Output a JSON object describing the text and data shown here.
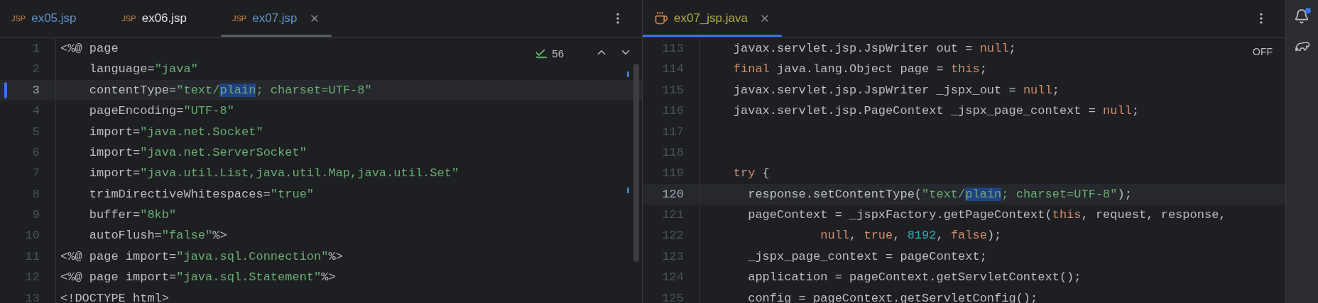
{
  "left_pane": {
    "tabs": [
      {
        "icon_text": "JSP",
        "label": "ex05.jsp",
        "color": "#5f93c9",
        "selected": false,
        "closable": false
      },
      {
        "icon_text": "JSP",
        "label": "ex06.jsp",
        "color": "#dfe1e5",
        "selected": false,
        "closable": false
      },
      {
        "icon_text": "JSP",
        "label": "ex07.jsp",
        "color": "#5f93c9",
        "selected": true,
        "closable": true
      }
    ],
    "inspections": {
      "count": "56"
    },
    "lines": [
      {
        "number": "1",
        "current": false,
        "tokens": [
          {
            "kind": "plain",
            "text": "<%@ page"
          }
        ]
      },
      {
        "number": "2",
        "current": false,
        "tokens": [
          {
            "kind": "plain",
            "text": "    language="
          },
          {
            "kind": "string",
            "text": "\"java\""
          }
        ]
      },
      {
        "number": "3",
        "current": true,
        "tokens": [
          {
            "kind": "plain",
            "text": "    contentType="
          },
          {
            "kind": "string",
            "text": "\"text/"
          },
          {
            "kind": "match",
            "text": "plain"
          },
          {
            "kind": "string",
            "text": "; charset=UTF-8\""
          }
        ]
      },
      {
        "number": "4",
        "current": false,
        "tokens": [
          {
            "kind": "plain",
            "text": "    pageEncoding="
          },
          {
            "kind": "string",
            "text": "\"UTF-8\""
          }
        ]
      },
      {
        "number": "5",
        "current": false,
        "tokens": [
          {
            "kind": "plain",
            "text": "    import="
          },
          {
            "kind": "string",
            "text": "\"java.net.Socket\""
          }
        ]
      },
      {
        "number": "6",
        "current": false,
        "tokens": [
          {
            "kind": "plain",
            "text": "    import="
          },
          {
            "kind": "string",
            "text": "\"java.net.ServerSocket\""
          }
        ]
      },
      {
        "number": "7",
        "current": false,
        "tokens": [
          {
            "kind": "plain",
            "text": "    import="
          },
          {
            "kind": "string",
            "text": "\"java.util.List,java.util.Map,java.util.Set\""
          }
        ]
      },
      {
        "number": "8",
        "current": false,
        "tokens": [
          {
            "kind": "plain",
            "text": "    trimDirectiveWhitespaces="
          },
          {
            "kind": "string",
            "text": "\"true\""
          }
        ]
      },
      {
        "number": "9",
        "current": false,
        "tokens": [
          {
            "kind": "plain",
            "text": "    buffer="
          },
          {
            "kind": "string",
            "text": "\"8kb\""
          }
        ]
      },
      {
        "number": "10",
        "current": false,
        "tokens": [
          {
            "kind": "plain",
            "text": "    autoFlush="
          },
          {
            "kind": "string",
            "text": "\"false\""
          },
          {
            "kind": "plain",
            "text": "%>"
          }
        ]
      },
      {
        "number": "11",
        "current": false,
        "tokens": [
          {
            "kind": "plain",
            "text": "<%@ page import="
          },
          {
            "kind": "string",
            "text": "\"java.sql.Connection\""
          },
          {
            "kind": "plain",
            "text": "%>"
          }
        ]
      },
      {
        "number": "12",
        "current": false,
        "tokens": [
          {
            "kind": "plain",
            "text": "<%@ page import="
          },
          {
            "kind": "string",
            "text": "\"java.sql.Statement\""
          },
          {
            "kind": "plain",
            "text": "%>"
          }
        ]
      },
      {
        "number": "13",
        "current": false,
        "tokens": [
          {
            "kind": "plain",
            "text": "<!DOCTYPE html>"
          }
        ]
      }
    ]
  },
  "right_pane": {
    "tabs": [
      {
        "label": "ex07_jsp.java",
        "color": "#b0ad45",
        "selected": true,
        "closable": true
      }
    ],
    "reader_mode": "OFF",
    "lines": [
      {
        "number": "113",
        "current": false,
        "tokens": [
          {
            "kind": "plain",
            "text": "    javax.servlet.jsp.JspWriter out = "
          },
          {
            "kind": "keyword",
            "text": "null"
          },
          {
            "kind": "plain",
            "text": ";"
          }
        ]
      },
      {
        "number": "114",
        "current": false,
        "tokens": [
          {
            "kind": "keyword",
            "text": "    final"
          },
          {
            "kind": "plain",
            "text": " java.lang.Object page = "
          },
          {
            "kind": "keyword",
            "text": "this"
          },
          {
            "kind": "plain",
            "text": ";"
          }
        ]
      },
      {
        "number": "115",
        "current": false,
        "tokens": [
          {
            "kind": "plain",
            "text": "    javax.servlet.jsp.JspWriter _jspx_out = "
          },
          {
            "kind": "keyword",
            "text": "null"
          },
          {
            "kind": "plain",
            "text": ";"
          }
        ]
      },
      {
        "number": "116",
        "current": false,
        "tokens": [
          {
            "kind": "plain",
            "text": "    javax.servlet.jsp.PageContext _jspx_page_context = "
          },
          {
            "kind": "keyword",
            "text": "null"
          },
          {
            "kind": "plain",
            "text": ";"
          }
        ]
      },
      {
        "number": "117",
        "current": false
      },
      {
        "number": "118",
        "current": false
      },
      {
        "number": "119",
        "current": false,
        "tokens": [
          {
            "kind": "keyword",
            "text": "    try"
          },
          {
            "kind": "plain",
            "text": " {"
          }
        ]
      },
      {
        "number": "120",
        "current": true,
        "tokens": [
          {
            "kind": "plain",
            "text": "      response.setContentType("
          },
          {
            "kind": "string",
            "text": "\"text/"
          },
          {
            "kind": "match",
            "text": "plain"
          },
          {
            "kind": "string",
            "text": "; charset=UTF-8\""
          },
          {
            "kind": "plain",
            "text": ");"
          }
        ]
      },
      {
        "number": "121",
        "current": false,
        "tokens": [
          {
            "kind": "plain",
            "text": "      pageContext = _jspxFactory.getPageContext("
          },
          {
            "kind": "keyword",
            "text": "this"
          },
          {
            "kind": "plain",
            "text": ", request, response,"
          }
        ]
      },
      {
        "number": "122",
        "current": false,
        "tokens": [
          {
            "kind": "keyword",
            "text": "                null"
          },
          {
            "kind": "plain",
            "text": ", "
          },
          {
            "kind": "keyword",
            "text": "true"
          },
          {
            "kind": "plain",
            "text": ", "
          },
          {
            "kind": "number",
            "text": "8192"
          },
          {
            "kind": "plain",
            "text": ", "
          },
          {
            "kind": "keyword",
            "text": "false"
          },
          {
            "kind": "plain",
            "text": ");"
          }
        ]
      },
      {
        "number": "123",
        "current": false,
        "tokens": [
          {
            "kind": "plain",
            "text": "      _jspx_page_context = pageContext;"
          }
        ]
      },
      {
        "number": "124",
        "current": false,
        "tokens": [
          {
            "kind": "plain",
            "text": "      application = pageContext.getServletContext();"
          }
        ]
      },
      {
        "number": "125",
        "current": false,
        "tokens": [
          {
            "kind": "plain",
            "text": "      config = pageContext.getServletConfig();"
          }
        ]
      }
    ]
  },
  "sidebar": {
    "notification_unread": true
  }
}
